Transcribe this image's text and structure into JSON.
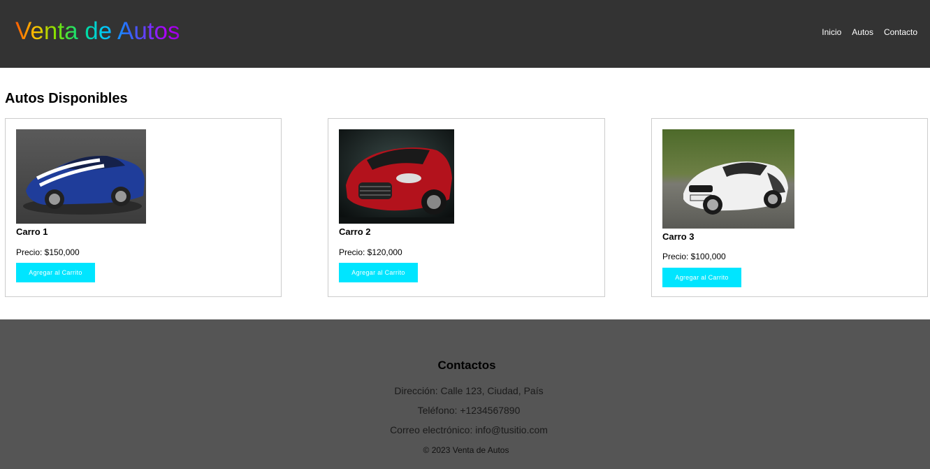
{
  "header": {
    "logo": "Venta de Autos",
    "nav": [
      "Inicio",
      "Autos",
      "Contacto"
    ]
  },
  "main": {
    "section_title": "Autos Disponibles",
    "cars": [
      {
        "name": "Carro 1",
        "price": "Precio: $150,000",
        "button": "Agregar al Carrito",
        "image": "blue-sports-car-image",
        "color": "#1f3d9a"
      },
      {
        "name": "Carro 2",
        "price": "Precio: $120,000",
        "button": "Agregar al Carrito",
        "image": "red-concept-car-image",
        "color": "#c0141e"
      },
      {
        "name": "Carro 3",
        "price": "Precio: $100,000",
        "button": "Agregar al Carrito",
        "image": "white-sports-car-image",
        "color": "#f2f2f2"
      }
    ]
  },
  "footer": {
    "title": "Contactos",
    "address": "Dirección: Calle 123, Ciudad, País",
    "phone": "Teléfono: +1234567890",
    "email": "Correo electrónico: info@tusitio.com",
    "copyright": "© 2023 Venta de Autos"
  },
  "colors": {
    "header_bg": "#333333",
    "footer_bg": "#555555",
    "button_bg": "#00e5ff",
    "card_border": "#cccccc"
  }
}
